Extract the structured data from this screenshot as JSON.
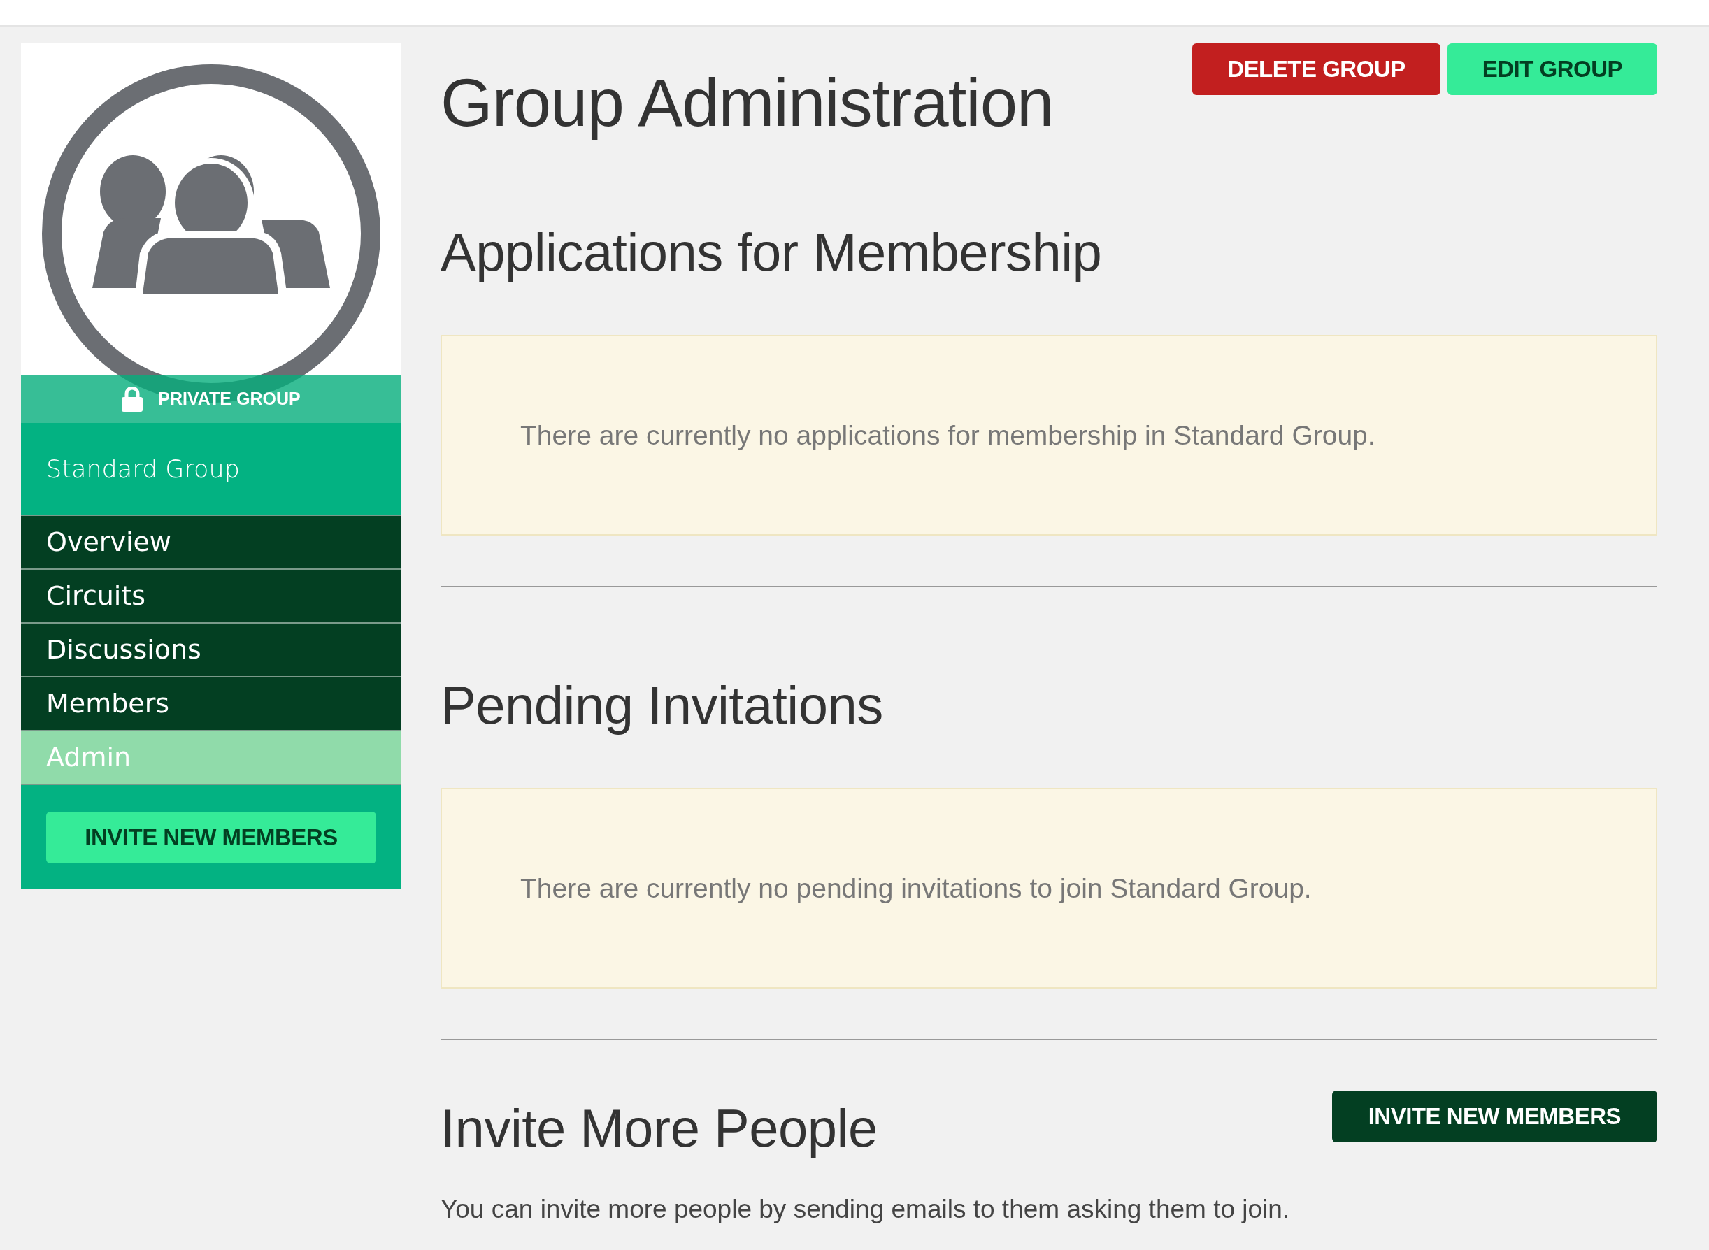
{
  "sidebar": {
    "privacy_badge": "PRIVATE GROUP",
    "group_name": "Standard Group",
    "nav_items": [
      {
        "label": "Overview",
        "selected": false
      },
      {
        "label": "Circuits",
        "selected": false
      },
      {
        "label": "Discussions",
        "selected": false
      },
      {
        "label": "Members",
        "selected": false
      },
      {
        "label": "Admin",
        "selected": true
      }
    ],
    "invite_button": "INVITE NEW MEMBERS"
  },
  "header": {
    "title": "Group Administration",
    "buttons": [
      {
        "label": "DELETE GROUP",
        "kind": "danger"
      },
      {
        "label": "EDIT GROUP",
        "kind": "primary"
      }
    ]
  },
  "sections": [
    {
      "heading": "Applications for Membership",
      "message": "There are currently no applications for membership in Standard Group."
    },
    {
      "heading": "Pending Invitations",
      "message": "There are currently no pending invitations to join Standard Group."
    }
  ],
  "invite": {
    "heading": "Invite More People",
    "button": "INVITE NEW MEMBERS",
    "text": "You can invite more people by sending emails to them asking them to join."
  }
}
